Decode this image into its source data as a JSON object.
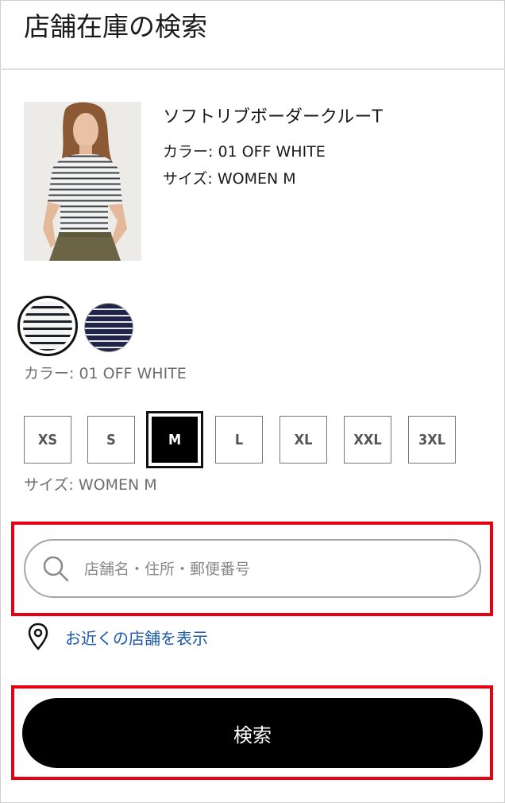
{
  "header": {
    "title": "店舗在庫の検索"
  },
  "product": {
    "name": "ソフトリブボーダークルーT",
    "color_line": "カラー: 01 OFF WHITE",
    "size_line": "サイズ: WOMEN M"
  },
  "colors": {
    "caption": "カラー: 01 OFF WHITE",
    "swatches": [
      {
        "name": "01 OFF WHITE",
        "stripe": "#1c1f2a",
        "base": "#f4f4f2",
        "selected": true
      },
      {
        "name": "NAVY",
        "stripe": "#e8e8ee",
        "base": "#1f2546",
        "selected": false
      }
    ]
  },
  "sizes": {
    "options": [
      "XS",
      "S",
      "M",
      "L",
      "XL",
      "XXL",
      "3XL"
    ],
    "selected": "M",
    "caption": "サイズ: WOMEN M"
  },
  "search": {
    "placeholder": "店舗名・住所・郵便番号",
    "value": "",
    "icon": "search-icon"
  },
  "nearby": {
    "label": "お近くの店舗を表示",
    "icon": "location-pin-icon"
  },
  "submit": {
    "label": "検索"
  },
  "colors_ui": {
    "highlight": "#e50012",
    "link": "#1d5aa8",
    "button_bg": "#000000",
    "button_text": "#ffffff"
  }
}
